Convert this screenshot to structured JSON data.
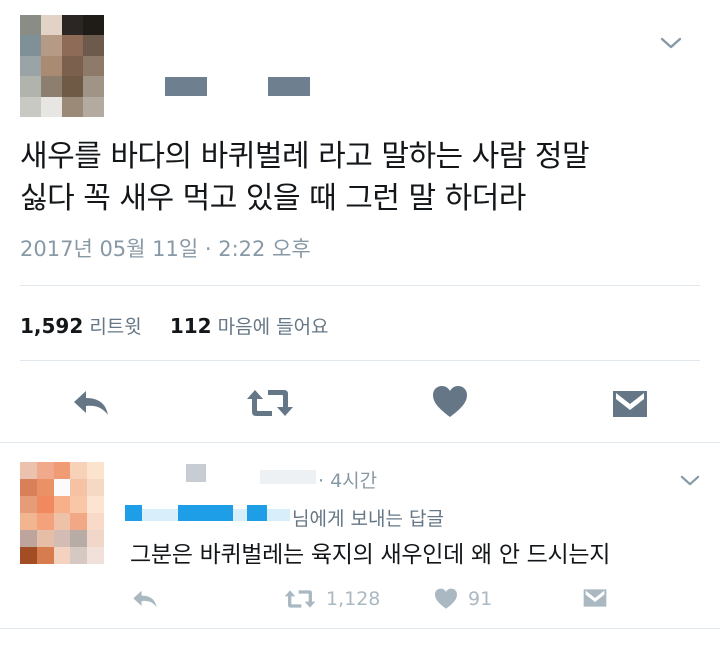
{
  "tweet": {
    "text_lines": [
      "새우를 바다의 바퀴벌레 라고 말하는 사람 정말",
      "싫다 꼭 새우 먹고 있을 때 그런 말 하더라"
    ],
    "timestamp": "2017년 05월 11일 · 2:22 오후",
    "retweet_count": "1,592",
    "retweet_label": "리트윗",
    "like_count": "112",
    "like_label": "마음에 들어요"
  },
  "reply": {
    "time": "· 4시간",
    "reply_to_suffix": "님에게 보내는 답글",
    "text": "그분은 바퀴벌레는 육지의 새우인데 왜 안 드시는지",
    "retweet_count": "1,128",
    "like_count": "91"
  },
  "icons": {
    "menu": "chevron-down-icon",
    "reply": "reply-arrow-icon",
    "retweet": "retweet-icon",
    "like": "heart-icon",
    "dm": "envelope-icon"
  },
  "colors": {
    "text": "#14171a",
    "muted": "#8899a6",
    "icon": "#657786",
    "divider": "#e1e8ed",
    "blur_blue": "#1d9ee6"
  }
}
